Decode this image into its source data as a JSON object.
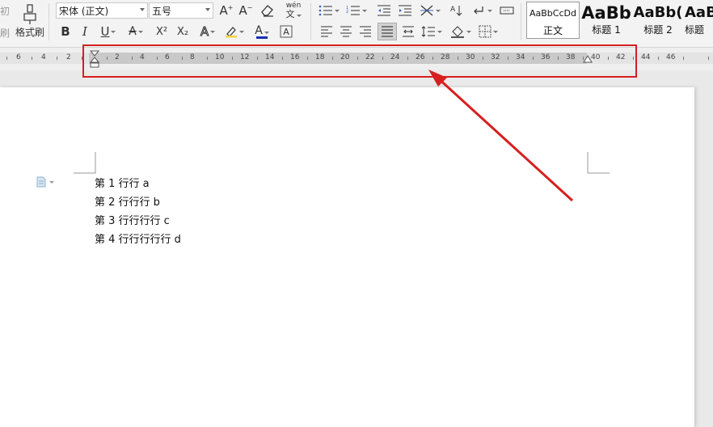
{
  "toolbar": {
    "paste_partial_label": "初",
    "paste_partial_label2": "刷",
    "format_painter_label": "格式刷",
    "font_name": "宋体 (正文)",
    "font_size": "五号",
    "phonetic_label": "wén",
    "icons": [
      "format-painter-icon",
      "bold-icon",
      "italic-icon",
      "underline-icon",
      "strikethrough-icon",
      "superscript-icon",
      "subscript-icon",
      "text-effect-icon",
      "highlight-icon",
      "font-color-icon",
      "char-border-icon",
      "grow-font-icon",
      "shrink-font-icon",
      "clear-format-icon",
      "phonetic-icon",
      "bullets-icon",
      "numbering-icon",
      "decrease-indent-icon",
      "increase-indent-icon",
      "chinese-layout-icon",
      "sort-icon",
      "show-marks-icon",
      "tab-icon",
      "align-left-icon",
      "align-center-icon",
      "align-right-icon",
      "justify-icon",
      "distributed-icon",
      "line-spacing-icon",
      "shading-icon",
      "borders-icon"
    ],
    "bold_label": "B",
    "italic_label": "I",
    "underline_label": "U",
    "superscript_label": "X²",
    "subscript_label": "X₂"
  },
  "styles": [
    {
      "sample": "AaBbCcDd",
      "name": "正文"
    },
    {
      "sample": "AaBb",
      "name": "标题 1"
    },
    {
      "sample": "AaBb(",
      "name": "标题 2"
    },
    {
      "sample": "AaB",
      "name": "标题"
    }
  ],
  "ruler": {
    "left_numbers": [
      "6",
      "4",
      "2"
    ],
    "numbers": [
      "2",
      "4",
      "6",
      "8",
      "10",
      "12",
      "14",
      "16",
      "18",
      "20",
      "22",
      "24",
      "26",
      "28",
      "30",
      "32",
      "34",
      "36",
      "38",
      "40",
      "42",
      "44",
      "46"
    ]
  },
  "document": {
    "lines": [
      "第 1 行行 a",
      "第 2 行行行 b",
      "第 3 行行行行 c",
      "第 4 行行行行行 d"
    ]
  },
  "colors": {
    "annotation_red": "#d61f1f",
    "ruler_band": "#c9c9c9",
    "toolbar_bg": "#f3f3f3"
  }
}
